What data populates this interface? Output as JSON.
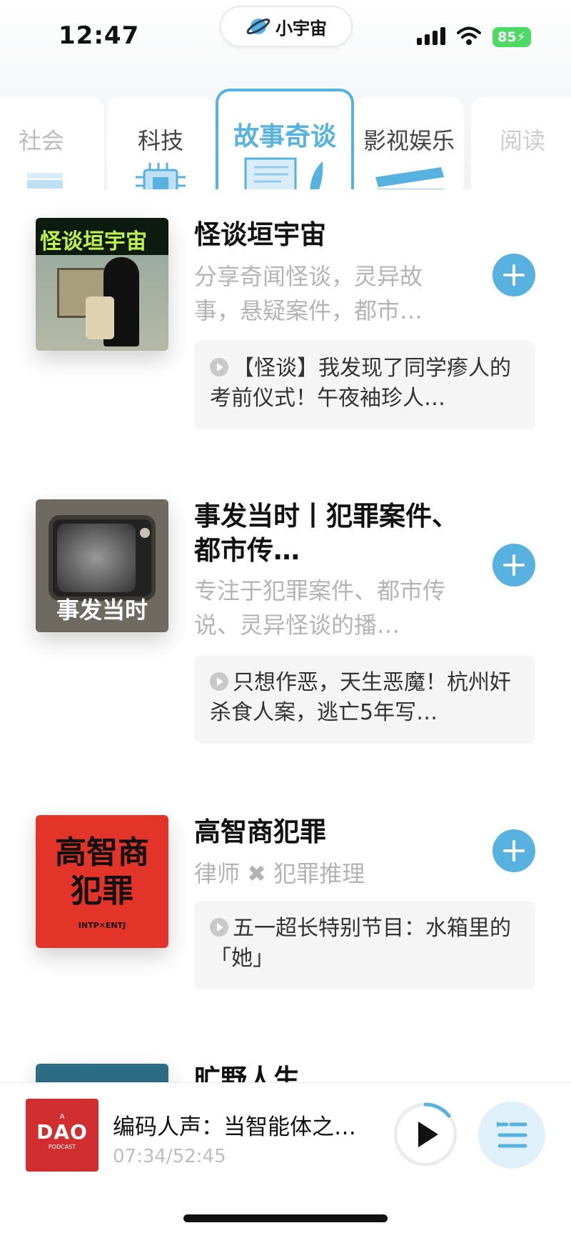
{
  "status_bar": {
    "time": "12:47",
    "app_name": "小宇宙",
    "battery": "85"
  },
  "tabs": [
    {
      "label": "社会",
      "state": "partial"
    },
    {
      "label": "科技",
      "state": "normal"
    },
    {
      "label": "故事奇谈",
      "state": "selected"
    },
    {
      "label": "影视娱乐",
      "state": "normal"
    },
    {
      "label": "阅读",
      "state": "partial"
    }
  ],
  "podcasts": [
    {
      "title": "怪谈垣宇宙",
      "description": "分享奇闻怪谈，灵异故事，悬疑案件，都市…",
      "latest_episode": "【怪谈】我发现了同学瘆人的考前仪式！午夜袖珍人…",
      "cover_text": "怪谈垣宇宙"
    },
    {
      "title": "事发当时丨犯罪案件、都市传…",
      "description": "专注于犯罪案件、都市传说、灵异怪谈的播…",
      "latest_episode": "只想作恶，天生恶魔！杭州奸杀食人案，逃亡5年写…",
      "cover_text": "事发当时"
    },
    {
      "title": "高智商犯罪",
      "description": "律师 ✖ 犯罪推理",
      "latest_episode": "五一超长特别节目：水箱里的「她」",
      "cover_text": "高智商犯罪",
      "cover_subtext": "INTP✕ENTJ"
    },
    {
      "title": "旷野人生",
      "description": "",
      "latest_episode": "",
      "cover_text": ""
    }
  ],
  "player": {
    "title": "编码人声：当智能体之…",
    "time": "07:34/52:45",
    "progress": 0.144,
    "cover_top": "A",
    "cover_logo": "DAO",
    "cover_bottom": "PODCAST"
  },
  "colors": {
    "accent": "#58b2e0",
    "cover_red": "#e3342a",
    "player_cover": "#d12f2f"
  },
  "icons": [
    "back-arrow-icon",
    "chevron-down-icon",
    "planet-icon",
    "add-icon",
    "play-icon",
    "queue-icon"
  ]
}
